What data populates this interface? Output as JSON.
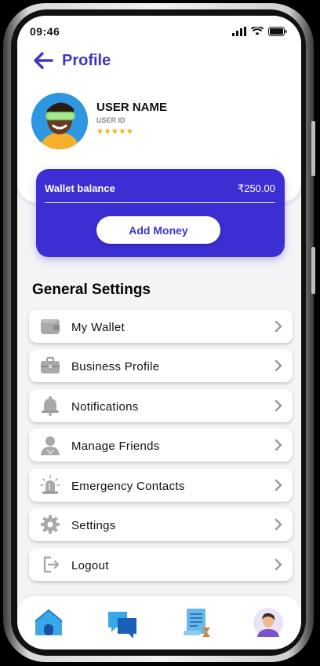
{
  "status_bar": {
    "time": "09:46"
  },
  "header": {
    "title": "Profile"
  },
  "user": {
    "name": "USER NAME",
    "id_label": "USER ID",
    "rating_stars": 5,
    "rating_display": "★★★★★"
  },
  "wallet": {
    "label": "Wallet balance",
    "amount": "₹250.00",
    "add_money_label": "Add Money"
  },
  "settings": {
    "title": "General Settings",
    "items": [
      {
        "label": "My Wallet",
        "icon": "wallet-icon"
      },
      {
        "label": "Business Profile",
        "icon": "briefcase-icon"
      },
      {
        "label": "Notifications",
        "icon": "bell-icon"
      },
      {
        "label": "Manage Friends",
        "icon": "person-icon"
      },
      {
        "label": "Emergency Contacts",
        "icon": "siren-icon"
      },
      {
        "label": "Settings",
        "icon": "gear-icon"
      },
      {
        "label": "Logout",
        "icon": "logout-icon"
      }
    ]
  },
  "bottom_nav": {
    "items": [
      {
        "icon": "home-icon"
      },
      {
        "icon": "chat-icon"
      },
      {
        "icon": "history-icon"
      },
      {
        "icon": "profile-avatar-icon"
      }
    ]
  },
  "colors": {
    "accent": "#3f34cc",
    "wallet_bg": "#3b2fd3",
    "star": "#f2b200"
  }
}
